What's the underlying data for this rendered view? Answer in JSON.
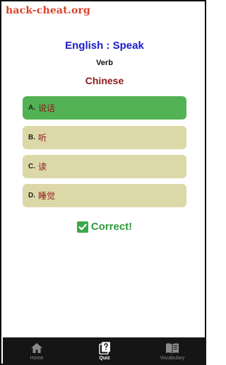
{
  "watermark": "hack-cheat.org",
  "quiz": {
    "prompt": "English : Speak",
    "part_of_speech": "Verb",
    "target_language": "Chinese"
  },
  "options": [
    {
      "letter": "A.",
      "text": "说话",
      "state": "correct"
    },
    {
      "letter": "B.",
      "text": "听",
      "state": "default"
    },
    {
      "letter": "C.",
      "text": "读",
      "state": "default"
    },
    {
      "letter": "D.",
      "text": "睡觉",
      "state": "default"
    }
  ],
  "feedback": {
    "icon": "check-icon",
    "text": "Correct!"
  },
  "nav": {
    "items": [
      {
        "label": "Home",
        "icon": "home-icon",
        "active": false
      },
      {
        "label": "Quiz",
        "icon": "quiz-icon",
        "active": true
      },
      {
        "label": "Vocabulary",
        "icon": "book-icon",
        "active": false
      }
    ]
  },
  "colors": {
    "correct_option": "#52b254",
    "option": "#dcd8a8",
    "title": "#1a1acc",
    "answer_text": "#8b1a1a",
    "feedback": "#2e9a3c",
    "navbar": "#151515"
  }
}
